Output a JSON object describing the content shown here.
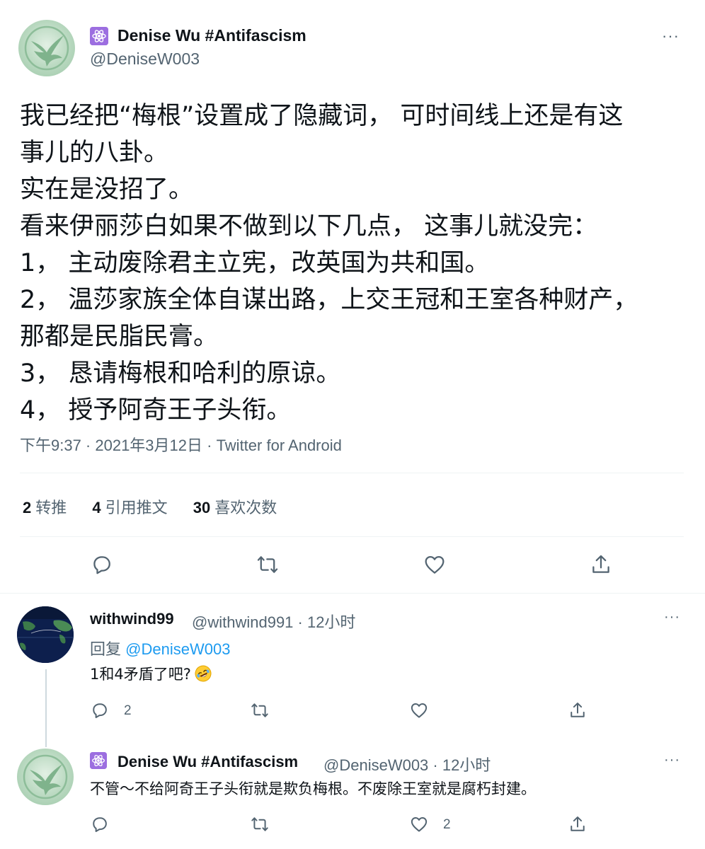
{
  "main_tweet": {
    "author_name": "Denise Wu #Antifascism",
    "handle": "@DeniseW003",
    "more": "···",
    "lines": [
      "我已经把“梅根”设置成了隐藏词， 可时间线上还是有这",
      "事儿的八卦。",
      "实在是没招了。",
      "看来伊丽莎白如果不做到以下几点， 这事儿就没完：",
      "1，  主动废除君主立宪，改英国为共和国。",
      "2，  温莎家族全体自谋出路，上交王冠和王室各种财产，",
      "那都是民脂民膏。",
      "3，  恳请梅根和哈利的原谅。",
      "4，  授予阿奇王子头衔。"
    ],
    "timestamp": "下午9:37 · 2021年3月12日 · Twitter for Android",
    "stats": {
      "retweets_num": "2",
      "retweets_label": "转推",
      "quotes_num": "4",
      "quotes_label": "引用推文",
      "likes_num": "30",
      "likes_label": "喜欢次数"
    }
  },
  "reply_1": {
    "author_name": "withwind99",
    "sub": "@withwind991 · 12小时",
    "replying_prefix": "回复",
    "replying_handle": "@DeniseW003",
    "text": "1和4矛盾了吧?",
    "reply_count": "2",
    "more": "···"
  },
  "reply_2": {
    "author_name": "Denise Wu #Antifascism",
    "sub": "@DeniseW003 · 12小时",
    "text": "不管～不给阿奇王子头衔就是欺负梅根。不废除王室就是腐朽封建。",
    "like_count": "2",
    "more": "···"
  },
  "colors": {
    "text": "#0f1419",
    "secondary": "#536471",
    "link": "#1d9bf0",
    "badge": "#9c6ee0"
  },
  "icons": [
    "reply-icon",
    "retweet-icon",
    "like-icon",
    "share-icon",
    "more-icon",
    "atom-badge-icon",
    "rofl-emoji-icon"
  ]
}
